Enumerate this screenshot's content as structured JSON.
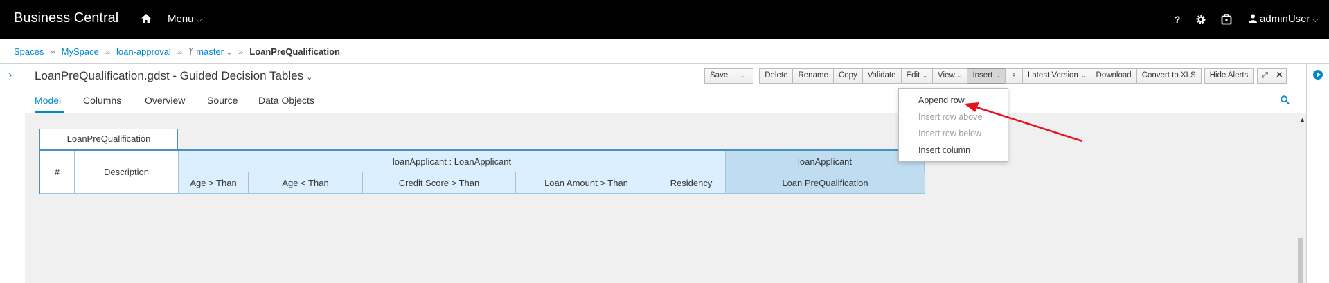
{
  "app": {
    "brand": "Business Central",
    "menu_label": "Menu",
    "user_label": "adminUser"
  },
  "breadcrumbs": {
    "items": [
      "Spaces",
      "MySpace",
      "loan-approval",
      "master"
    ],
    "current": "LoanPreQualification"
  },
  "editor": {
    "file_title": "LoanPreQualification.gdst - Guided Decision Tables",
    "toolbar": {
      "save": "Save",
      "delete": "Delete",
      "rename": "Rename",
      "copy": "Copy",
      "validate": "Validate",
      "edit": "Edit",
      "view": "View",
      "insert": "Insert",
      "latest_version": "Latest Version",
      "download": "Download",
      "convert": "Convert to XLS",
      "hide_alerts": "Hide Alerts"
    },
    "tabs": [
      "Model",
      "Columns",
      "Overview",
      "Source",
      "Data Objects"
    ],
    "active_tab": "Model"
  },
  "insert_menu": {
    "items": [
      {
        "label": "Append row",
        "enabled": true
      },
      {
        "label": "Insert row above",
        "enabled": false
      },
      {
        "label": "Insert row below",
        "enabled": false
      },
      {
        "label": "Insert column",
        "enabled": true
      }
    ]
  },
  "decision_table": {
    "name": "LoanPreQualification",
    "row_number_header": "#",
    "description_header": "Description",
    "pattern_1": "loanApplicant : LoanApplicant",
    "pattern_2": "loanApplicant",
    "columns": [
      "Age > Than",
      "Age < Than",
      "Credit Score > Than",
      "Loan Amount > Than",
      "Residency",
      "Loan PreQualification"
    ]
  },
  "colors": {
    "accent": "#0088ce",
    "annotation_arrow": "#e3141b",
    "table_header_light": "#dcefff",
    "table_header_dark": "#bfdcf0"
  }
}
